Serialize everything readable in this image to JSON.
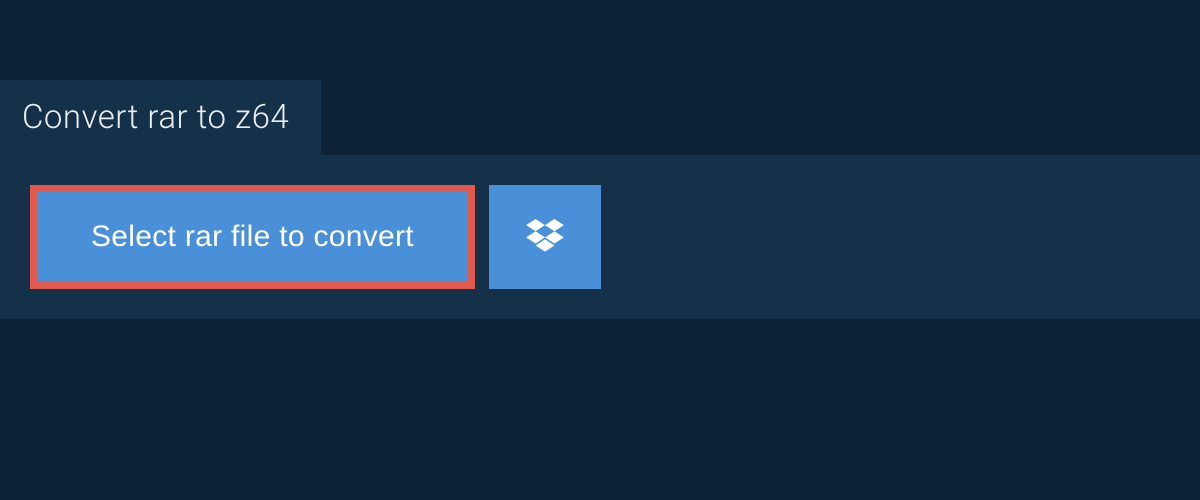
{
  "tab": {
    "title": "Convert rar to z64"
  },
  "actions": {
    "select_label": "Select rar file to convert",
    "dropbox_icon": "dropbox-icon"
  },
  "colors": {
    "background": "#0c2237",
    "panel": "#153049",
    "button": "#4a90d9",
    "highlight_border": "#e05a4f",
    "text_light": "#e8edf2",
    "text_white": "#ffffff"
  }
}
